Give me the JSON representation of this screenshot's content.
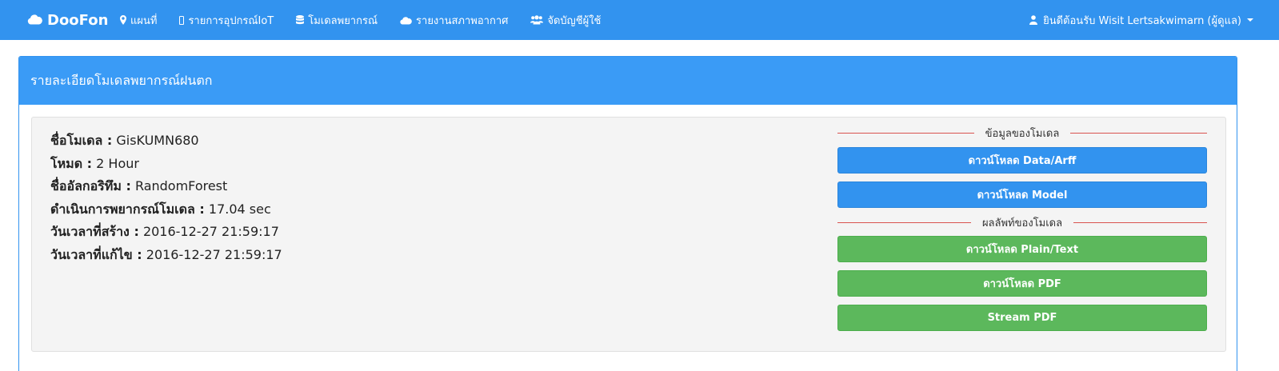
{
  "navbar": {
    "brand": "DooFon",
    "items": [
      {
        "label": "แผนที่",
        "icon": "map-marker-icon"
      },
      {
        "label": "รายการอุปกรณ์IoT",
        "icon": "device-icon"
      },
      {
        "label": "โมเดลพยากรณ์",
        "icon": "database-icon"
      },
      {
        "label": "รายงานสภาพอากาศ",
        "icon": "cloud-icon"
      },
      {
        "label": "จัดบัญชีผู้ใช้",
        "icon": "users-icon"
      }
    ],
    "user_label": "ยินดีต้อนรับ Wisit Lertsakwimarn (ผู้ดูแล)"
  },
  "panel": {
    "title": "รายละเอียดโมเดลพยากรณ์ฝนตก"
  },
  "details": [
    {
      "label": "ชื่อโมเดล :",
      "value": "GisKUMN680"
    },
    {
      "label": "โหมด :",
      "value": "2 Hour"
    },
    {
      "label": "ชื่ออัลกอริทึม :",
      "value": "RandomForest"
    },
    {
      "label": "ดำเนินการพยากรณ์โมเดล :",
      "value": "17.04 sec"
    },
    {
      "label": "วันเวลาที่สร้าง :",
      "value": "2016-12-27 21:59:17"
    },
    {
      "label": "วันเวลาที่แก้ไข :",
      "value": "2016-12-27 21:59:17"
    }
  ],
  "model_section": {
    "title": "ข้อมูลของโมเดล",
    "buttons": [
      "ดาวน์โหลด Data/Arff",
      "ดาวน์โหลด Model"
    ]
  },
  "result_section": {
    "title": "ผลลัพท์ของโมเดล",
    "buttons": [
      "ดาวน์โหลด Plain/Text",
      "ดาวน์โหลด PDF",
      "Stream PDF"
    ]
  },
  "colors": {
    "primary": "#3293ef",
    "success": "#5cb85c",
    "divider": "#d9534f"
  }
}
